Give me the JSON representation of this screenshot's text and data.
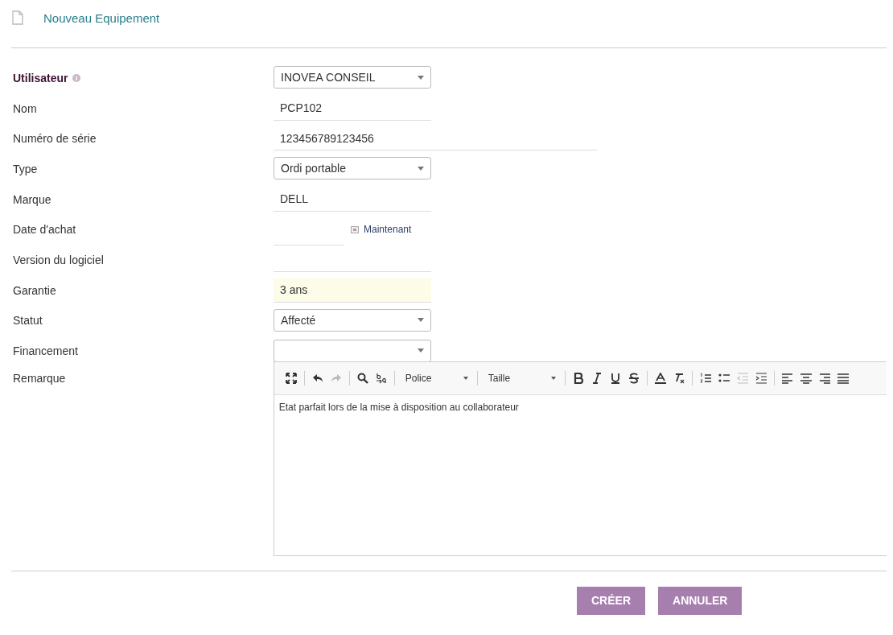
{
  "header": {
    "title": "Nouveau Equipement"
  },
  "fields": [
    {
      "label": "Utilisateur",
      "emphasized": true,
      "kind": "select",
      "value": "INOVEA CONSEIL"
    },
    {
      "label": "Nom",
      "emphasized": false,
      "kind": "text",
      "value": "PCP102",
      "wide": false,
      "highlighted": false
    },
    {
      "label": "Numéro de série",
      "emphasized": false,
      "kind": "text",
      "value": "123456789123456",
      "wide": true,
      "highlighted": false
    },
    {
      "label": "Type",
      "emphasized": false,
      "kind": "select",
      "value": "Ordi portable"
    },
    {
      "label": "Marque",
      "emphasized": false,
      "kind": "text",
      "value": "DELL",
      "wide": false,
      "highlighted": false
    },
    {
      "label": "Date d'achat",
      "emphasized": false,
      "kind": "date",
      "now_link": "Maintenant"
    },
    {
      "label": "Version du logiciel",
      "emphasized": false,
      "kind": "text",
      "wide": false,
      "highlighted": false
    },
    {
      "label": "Garantie",
      "emphasized": false,
      "kind": "text",
      "value": "3 ans",
      "wide": false,
      "highlighted": true
    },
    {
      "label": "Statut",
      "emphasized": false,
      "kind": "select",
      "value": "Affecté"
    },
    {
      "label": "Financement",
      "emphasized": false,
      "kind": "select"
    },
    {
      "label": "Remarque",
      "emphasized": false,
      "kind": "editor",
      "font_dropdown": "Police",
      "size_dropdown": "Taille",
      "content": "Etat parfait lors de la mise à disposition au collaborateur"
    }
  ],
  "toolbar": [
    {
      "kind": "maximize",
      "disabled": false
    },
    {
      "kind": "sep"
    },
    {
      "kind": "undo",
      "disabled": false
    },
    {
      "kind": "redo",
      "disabled": true
    },
    {
      "kind": "sep"
    },
    {
      "kind": "search",
      "disabled": false
    },
    {
      "kind": "replace",
      "disabled": false
    },
    {
      "kind": "sep"
    },
    {
      "kind": "font"
    },
    {
      "kind": "sep"
    },
    {
      "kind": "size"
    },
    {
      "kind": "sep"
    },
    {
      "kind": "bold",
      "disabled": false
    },
    {
      "kind": "italic",
      "disabled": false
    },
    {
      "kind": "underline",
      "disabled": false
    },
    {
      "kind": "strike",
      "disabled": false
    },
    {
      "kind": "sep"
    },
    {
      "kind": "textcolor",
      "disabled": false
    },
    {
      "kind": "clearformat",
      "disabled": false
    },
    {
      "kind": "sep"
    },
    {
      "kind": "numbered",
      "disabled": false
    },
    {
      "kind": "bulleted",
      "disabled": false
    },
    {
      "kind": "outdent",
      "disabled": true
    },
    {
      "kind": "indent",
      "disabled": false
    },
    {
      "kind": "sep"
    },
    {
      "kind": "alignleft",
      "disabled": false
    },
    {
      "kind": "aligncenter",
      "disabled": false
    },
    {
      "kind": "alignright",
      "disabled": false
    },
    {
      "kind": "justify",
      "disabled": false
    }
  ],
  "buttons": [
    "CRÉER",
    "ANNULER"
  ]
}
